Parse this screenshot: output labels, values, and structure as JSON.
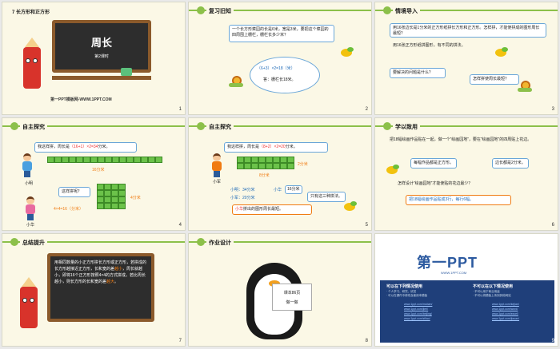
{
  "slides": [
    {
      "num": "1",
      "subtitle": "7 长方形和正方形",
      "board_title": "周长",
      "board_sub": "第2课时",
      "footer": "第一PPT模板网-WWW.1PPT.COM"
    },
    {
      "num": "2",
      "header": "复习旧知",
      "problem": "一个长方形菜园的长是6米，宽是3米，要把这个菜园的四周围上栅栏，栅栏长多少米？",
      "calc": "（6+3）×2=18（米）",
      "answer": "答：栅栏长18米。"
    },
    {
      "num": "3",
      "header": "情境导入",
      "text1": "用16张边长是1分米的正方形纸拼长方形和正方形。怎样拼，才能使拼成的图形周长最短？",
      "text2": "用16张正方形纸拼图形，有不同的拼法。",
      "bubble1": "要解决的问题是什么？",
      "bubble2": "怎样拼使周长最短？"
    },
    {
      "num": "4",
      "header": "自主探究",
      "line1a": "我这样拼，周长是",
      "line1b": "（16+1）×2=34",
      "line1c": "分米。",
      "bar_label": "16分米",
      "name1": "小明",
      "ask": "这样拼呢？",
      "side_label": "4分米",
      "calc2a": "4×4=16（分米）",
      "name2": "小华"
    },
    {
      "num": "5",
      "header": "自主探究",
      "line1a": "我这样拼，周长是",
      "line1b": "（8+2）×2=20",
      "line1c": "分米。",
      "label_2": "2分米",
      "label_8": "8分米",
      "name1": "小军",
      "ming": "小明：34分米",
      "hua": "小华",
      "hua_val": "16分米",
      "jun": "小军：20分米",
      "only3": "只有这三种拼法。",
      "conclusion_a": "小华",
      "conclusion_b": "拼出的图形周长最短。"
    },
    {
      "num": "6",
      "header": "学以致用",
      "task": "把18幅绘画作品贴在一起，做一个“绘画园地”，要在“绘画园地”的四周贴上花边。",
      "bubble1": "每幅作品都是正方形。",
      "bubble2": "边长都是2分米。",
      "question": "怎样设计“绘画园地”才能使贴的花边最少？",
      "answer": "把18幅绘画作品贴成3行，每行6幅。"
    },
    {
      "num": "7",
      "header": "总结提升",
      "summary_a": "用相同数量的小正方形拼长方形或正方形，若拼成的长方形越接近正方形，长和宽的差",
      "summary_red1": "越小",
      "summary_b": "，周长就越小，即将16个正方形按照4×4的方式拼成，若比周长越小，则长方形的长和宽的差",
      "summary_red2": "越大",
      "summary_c": "。"
    },
    {
      "num": "8",
      "header": "作业设计",
      "sign1": "课本86页",
      "sign2": "做一做"
    },
    {
      "num": "9",
      "logo": "第一PPT",
      "logo_url": "WWW.1PPT.COM",
      "col1_title": "可以在下列情况使用",
      "col2_title": "不可以在以下情况使用",
      "col1_lines": [
        "· 个人学习、研究、欣赏",
        "· 可以在课件中修改及使用本模板"
      ],
      "col2_lines": [
        "· 不可以用于商业用途",
        "· 不可以将模板上传到其他网站"
      ],
      "links1": [
        "www.1ppt.com/moban/",
        "www.1ppt.com/jieri/",
        "www.1ppt.com/beijing/",
        "www.1ppt.com/ziliao/"
      ],
      "links2": [
        "www.1ppt.com/kejian/",
        "www.1ppt.com/word/",
        "www.1ppt.com/excel/",
        "www.1ppt.com/jiaoan/"
      ]
    }
  ]
}
